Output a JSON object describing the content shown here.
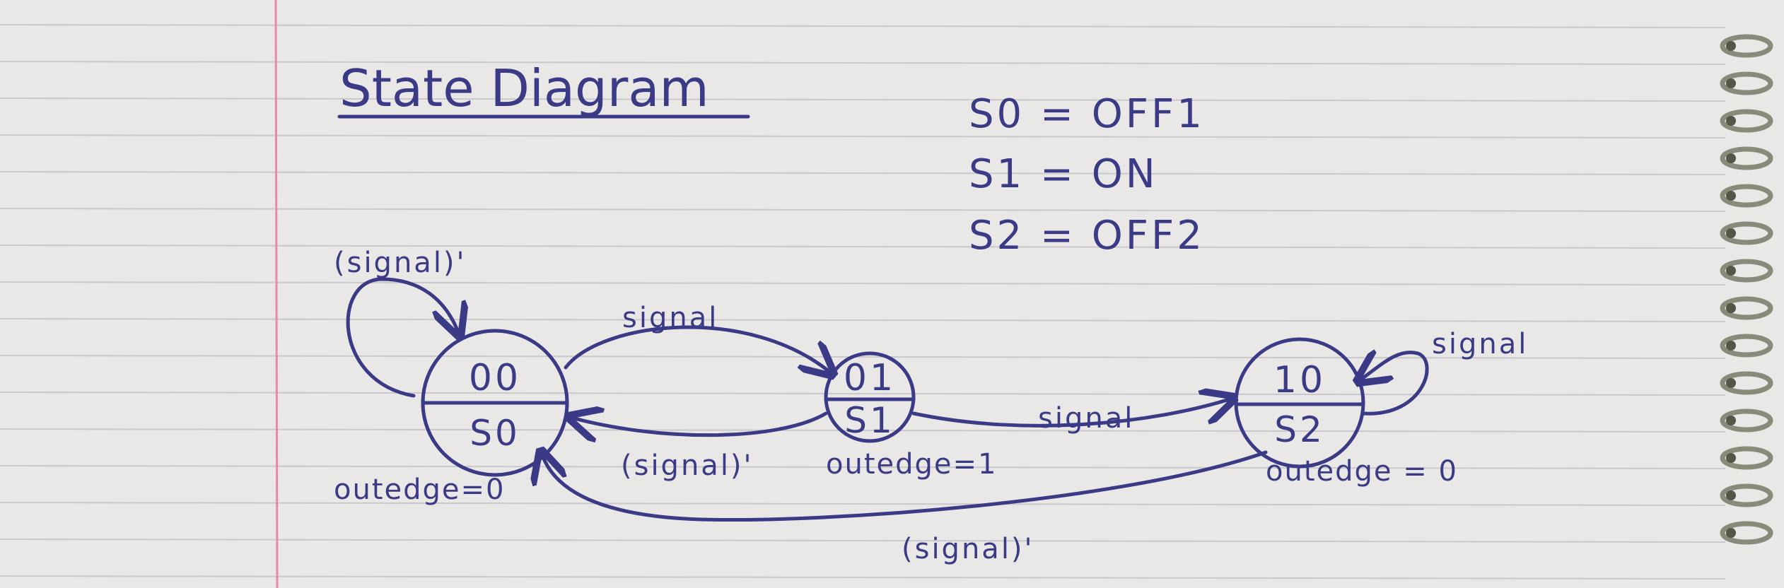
{
  "title": "State Diagram",
  "legend": [
    "S0 = OFF1",
    "S1 = ON",
    "S2 = OFF2"
  ],
  "states": [
    {
      "code": "00",
      "name": "S0",
      "output": "outedge=0"
    },
    {
      "code": "01",
      "name": "S1",
      "output": "outedge=1"
    },
    {
      "code": "10",
      "name": "S2",
      "output": "outedge = 0"
    }
  ],
  "transitions": [
    {
      "from": "S0",
      "to": "S0",
      "label": "(signal)'"
    },
    {
      "from": "S0",
      "to": "S1",
      "label": "signal"
    },
    {
      "from": "S1",
      "to": "S0",
      "label": "(signal)'"
    },
    {
      "from": "S1",
      "to": "S2",
      "label": "signal"
    },
    {
      "from": "S2",
      "to": "S2",
      "label": "signal"
    },
    {
      "from": "S2",
      "to": "S0",
      "label": "(signal)'"
    }
  ],
  "colors": {
    "paper": "#e9e8e6",
    "rule_line": "#c9c8cc",
    "margin_line": "#e58aa6",
    "ink": "#3a3a86",
    "binding": "#8a8a7a"
  }
}
